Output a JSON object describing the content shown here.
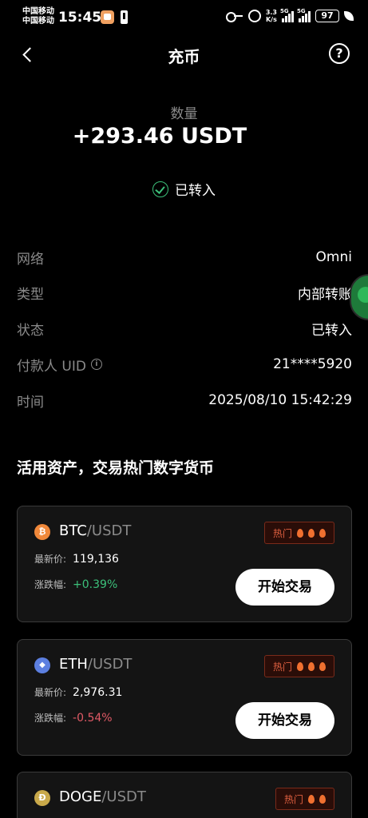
{
  "status_bar": {
    "carrier_1": "中国移动",
    "carrier_2": "中国移动",
    "time": "15:45",
    "speed_value": "3.3",
    "speed_unit": "K/s",
    "network_1": "5G",
    "network_2": "5G",
    "battery": "97"
  },
  "header": {
    "title": "充币",
    "help": "?"
  },
  "summary": {
    "quantity_label": "数量",
    "quantity_value": "+293.46 USDT",
    "status": "已转入"
  },
  "details": [
    {
      "label": "网络",
      "value": "Omni"
    },
    {
      "label": "类型",
      "value": "内部转账"
    },
    {
      "label": "状态",
      "value": "已转入"
    },
    {
      "label": "付款人 UID",
      "value": "21****5920"
    },
    {
      "label": "时间",
      "value": "2025/08/10  15:42:29"
    }
  ],
  "info_glyph": "i",
  "section_title": "活用资产，交易热门数字货币",
  "cards": [
    {
      "base": "BTC",
      "quote": "/USDT",
      "icon": "bitcoin-icon",
      "icon_color": "#f0883a",
      "icon_glyph": "₿",
      "hot": "热门",
      "price_label": "最新价:",
      "price": "119,136",
      "change_label": "涨跌幅:",
      "change": "+0.39%",
      "trend": "up",
      "button": "开始交易"
    },
    {
      "base": "ETH",
      "quote": "/USDT",
      "icon": "ethereum-icon",
      "icon_color": "#5c7fe0",
      "icon_glyph": "◆",
      "hot": "热门",
      "price_label": "最新价:",
      "price": "2,976.31",
      "change_label": "涨跌幅:",
      "change": "-0.54%",
      "trend": "down",
      "button": "开始交易"
    },
    {
      "base": "DOGE",
      "quote": "/USDT",
      "icon": "dogecoin-icon",
      "icon_color": "#c9a94a",
      "icon_glyph": "Ð",
      "hot": "热门"
    }
  ],
  "colors": {
    "up": "#3cc07a",
    "down": "#e05a66",
    "hot": "#e06040"
  }
}
